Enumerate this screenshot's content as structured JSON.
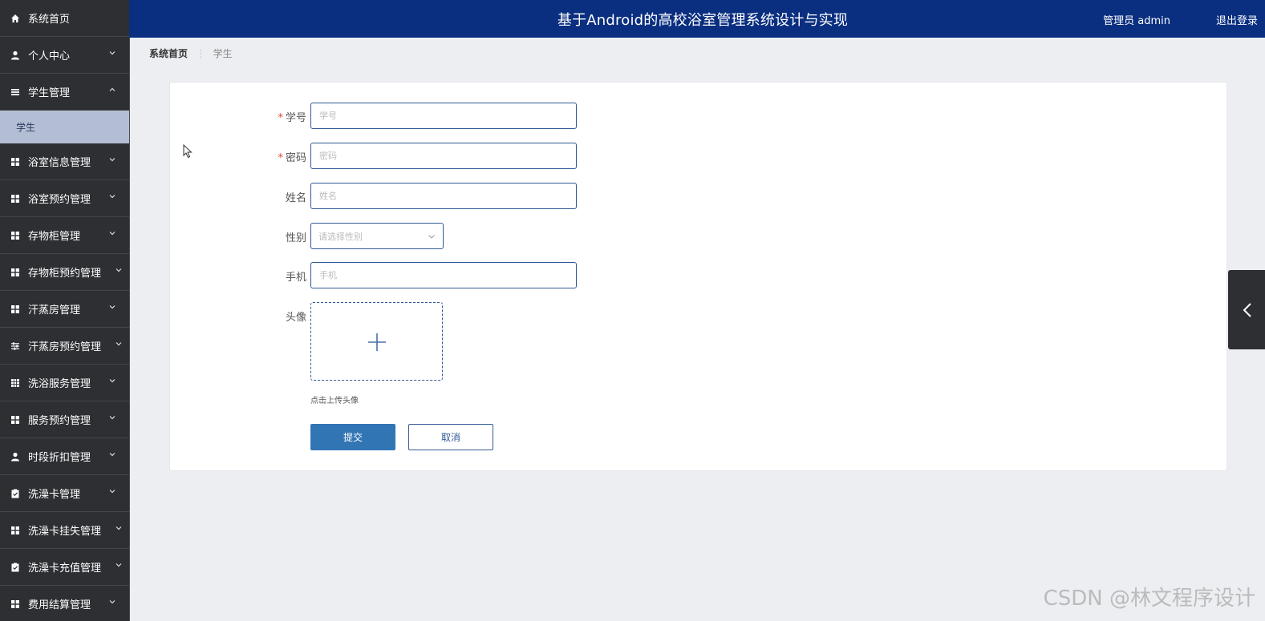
{
  "header": {
    "title": "基于Android的高校浴室管理系统设计与实现",
    "user": "管理员 admin",
    "logout": "退出登录"
  },
  "sidebar": {
    "items": [
      {
        "label": "系统首页",
        "icon": "home-icon",
        "expandable": false
      },
      {
        "label": "个人中心",
        "icon": "user-icon",
        "expandable": true
      },
      {
        "label": "学生管理",
        "icon": "list-icon",
        "expandable": true,
        "expanded": true,
        "children": [
          "学生"
        ]
      },
      {
        "label": "浴室信息管理",
        "icon": "grid-icon",
        "expandable": true
      },
      {
        "label": "浴室预约管理",
        "icon": "grid-icon",
        "expandable": true
      },
      {
        "label": "存物柜管理",
        "icon": "grid-icon",
        "expandable": true
      },
      {
        "label": "存物柜预约管理",
        "icon": "grid-icon",
        "expandable": true
      },
      {
        "label": "汗蒸房管理",
        "icon": "grid-icon",
        "expandable": true
      },
      {
        "label": "汗蒸房预约管理",
        "icon": "sliders-icon",
        "expandable": true
      },
      {
        "label": "洗浴服务管理",
        "icon": "table-icon",
        "expandable": true
      },
      {
        "label": "服务预约管理",
        "icon": "grid-icon",
        "expandable": true
      },
      {
        "label": "时段折扣管理",
        "icon": "user-icon",
        "expandable": true
      },
      {
        "label": "洗澡卡管理",
        "icon": "clipboard-icon",
        "expandable": true
      },
      {
        "label": "洗澡卡挂失管理",
        "icon": "grid-icon",
        "expandable": true
      },
      {
        "label": "洗澡卡充值管理",
        "icon": "clipboard-icon",
        "expandable": true
      },
      {
        "label": "费用结算管理",
        "icon": "grid-icon",
        "expandable": true
      }
    ]
  },
  "breadcrumb": {
    "home": "系统首页",
    "current": "学生"
  },
  "form": {
    "student_id": {
      "label": "学号",
      "placeholder": "学号",
      "required": true,
      "value": ""
    },
    "password": {
      "label": "密码",
      "placeholder": "密码",
      "required": true,
      "value": ""
    },
    "name": {
      "label": "姓名",
      "placeholder": "姓名",
      "required": false,
      "value": ""
    },
    "gender": {
      "label": "性别",
      "placeholder": "请选择性别",
      "required": false,
      "value": ""
    },
    "phone": {
      "label": "手机",
      "placeholder": "手机",
      "required": false,
      "value": ""
    },
    "avatar": {
      "label": "头像",
      "hint": "点击上传头像"
    },
    "required_mark": "*",
    "submit": "提交",
    "cancel": "取消"
  },
  "watermark": "CSDN @林文程序设计",
  "colors": {
    "header_bg": "#0a2e80",
    "sidebar_bg": "#2d2f33",
    "sidebar_active_bg": "#b3bdd3",
    "primary": "#3275b5",
    "border": "#2f5a96",
    "required": "#e0463a"
  }
}
